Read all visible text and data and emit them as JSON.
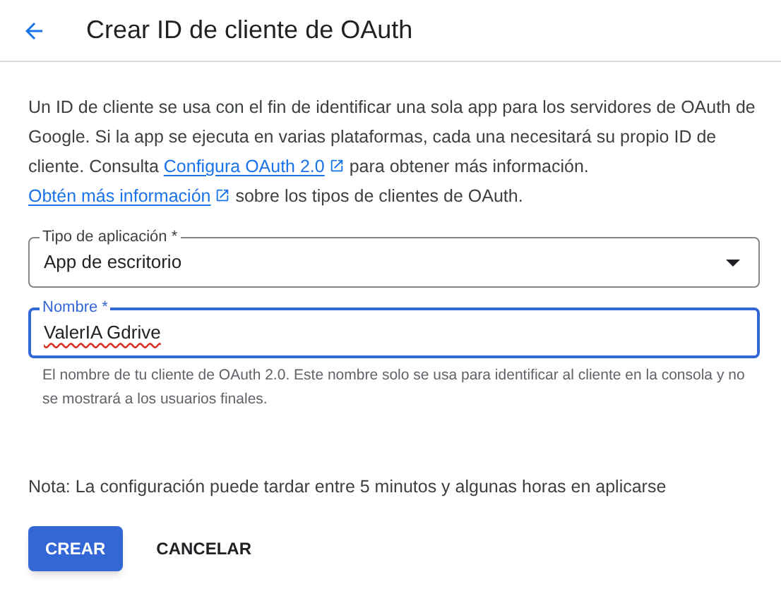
{
  "header": {
    "title": "Crear ID de cliente de OAuth"
  },
  "intro": [
    {
      "kind": "text",
      "text": "Un ID de cliente se usa con el fin de identificar una sola app para los servidores de OAuth de Google. Si la app se ejecuta en varias plataformas, cada una necesitará su propio ID de cliente. Consulta "
    },
    {
      "kind": "link",
      "text": "Configura OAuth 2.0"
    },
    {
      "kind": "text",
      "text": " para obtener más información. "
    },
    {
      "kind": "link",
      "text": "Obtén más información"
    },
    {
      "kind": "text",
      "text": " sobre los tipos de clientes de OAuth."
    }
  ],
  "fields": [
    {
      "kind": "select",
      "label": "Tipo de aplicación *",
      "value": "App de escritorio",
      "focused": false
    },
    {
      "kind": "text",
      "label": "Nombre *",
      "value": "ValerIA Gdrive",
      "focused": true,
      "spellcheck_error": true,
      "helper": "El nombre de tu cliente de OAuth 2.0. Este nombre solo se usa para identificar al cliente en la consola y no se mostrará a los usuarios finales."
    }
  ],
  "note": "Nota: La configuración puede tardar entre 5 minutos y algunas horas en aplicarse",
  "buttons": [
    {
      "label": "CREAR",
      "kind": "primary"
    },
    {
      "label": "CANCELAR",
      "kind": "text"
    }
  ]
}
